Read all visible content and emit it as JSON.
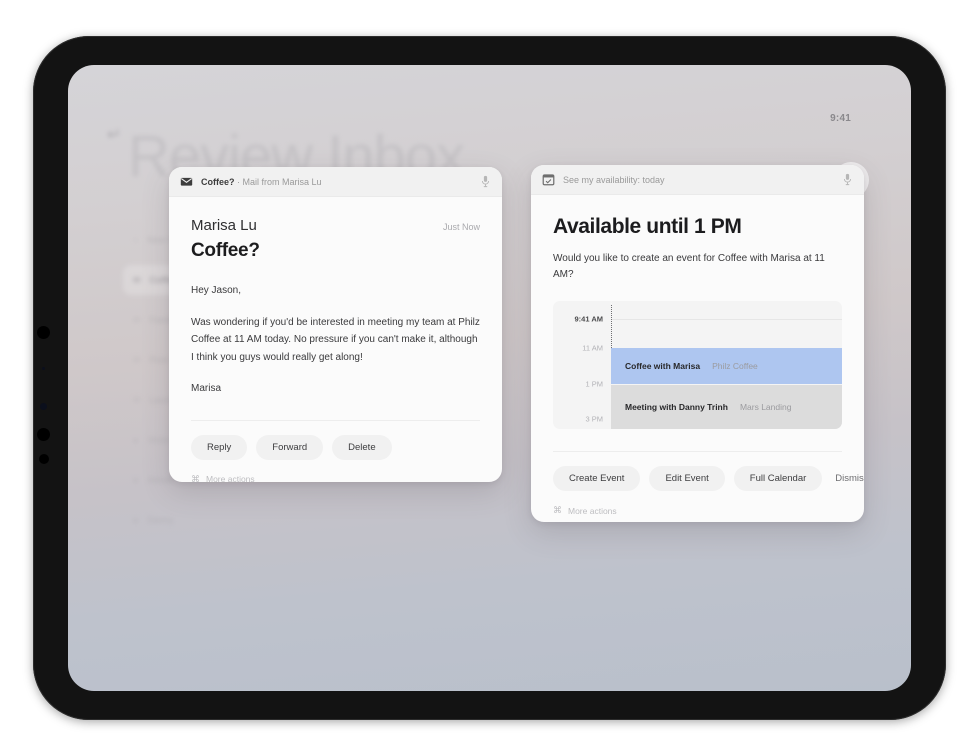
{
  "device": {
    "status_time": "9:41",
    "add_button_label": "+"
  },
  "background_app": {
    "back_icon": "back-arrow-icon",
    "title": "Review Inbox",
    "sidebar": [
      {
        "icon": "plus-icon",
        "label": "New f",
        "selected": false
      },
      {
        "icon": "envelope-icon",
        "label": "Coffee",
        "selected": true
      },
      {
        "icon": "envelope-icon",
        "label": "Feedb",
        "selected": false
      },
      {
        "icon": "envelope-icon",
        "label": "Post-",
        "selected": false
      },
      {
        "icon": "envelope-icon",
        "label": "Launc",
        "selected": false
      },
      {
        "icon": "circle-icon",
        "label": "Victor",
        "selected": false
      },
      {
        "icon": "circle-icon",
        "label": "Advait",
        "selected": false
      },
      {
        "icon": "circle-icon",
        "label": "Danny",
        "selected": false
      }
    ]
  },
  "mail_card": {
    "header": {
      "icon": "envelope-icon",
      "query": "Coffee?",
      "context": " · Mail from Marisa Lu",
      "mic_icon": "microphone-icon"
    },
    "sender": "Marisa Lu",
    "timestamp": "Just Now",
    "subject": "Coffee?",
    "greeting": "Hey Jason,",
    "body": "Was wondering if you'd be interested in meeting my team at Philz Coffee at 11 AM today. No pressure if you can't make it, although I think you guys would really get along!",
    "signoff": "Marisa",
    "buttons": [
      {
        "label": "Reply",
        "style": "pill"
      },
      {
        "label": "Forward",
        "style": "pill"
      },
      {
        "label": "Delete",
        "style": "pill"
      }
    ],
    "more_actions": {
      "glyph": "⌘",
      "label": "More actions"
    }
  },
  "calendar_card": {
    "header": {
      "icon": "calendar-icon",
      "query": "See my availability: today",
      "mic_icon": "microphone-icon"
    },
    "title": "Available until 1 PM",
    "subtitle": "Would you like to create an event for Coffee with Marisa at 11 AM?",
    "schedule": {
      "time_labels": [
        {
          "label": "9:41 AM",
          "is_now": true
        },
        {
          "label": "11 AM",
          "is_now": false
        },
        {
          "label": "1 PM",
          "is_now": false
        },
        {
          "label": "3 PM",
          "is_now": false
        }
      ],
      "events": [
        {
          "name": "Coffee with Marisa",
          "location": "Philz Coffee",
          "color": "#aec6f0"
        },
        {
          "name": "Meeting with Danny Trinh",
          "location": "Mars Landing",
          "color": "#dcdcdc"
        }
      ]
    },
    "buttons": [
      {
        "label": "Create Event",
        "style": "pill"
      },
      {
        "label": "Edit Event",
        "style": "pill"
      },
      {
        "label": "Full Calendar",
        "style": "pill"
      },
      {
        "label": "Dismiss",
        "style": "flat"
      }
    ],
    "more_actions": {
      "glyph": "⌘",
      "label": "More actions"
    }
  }
}
